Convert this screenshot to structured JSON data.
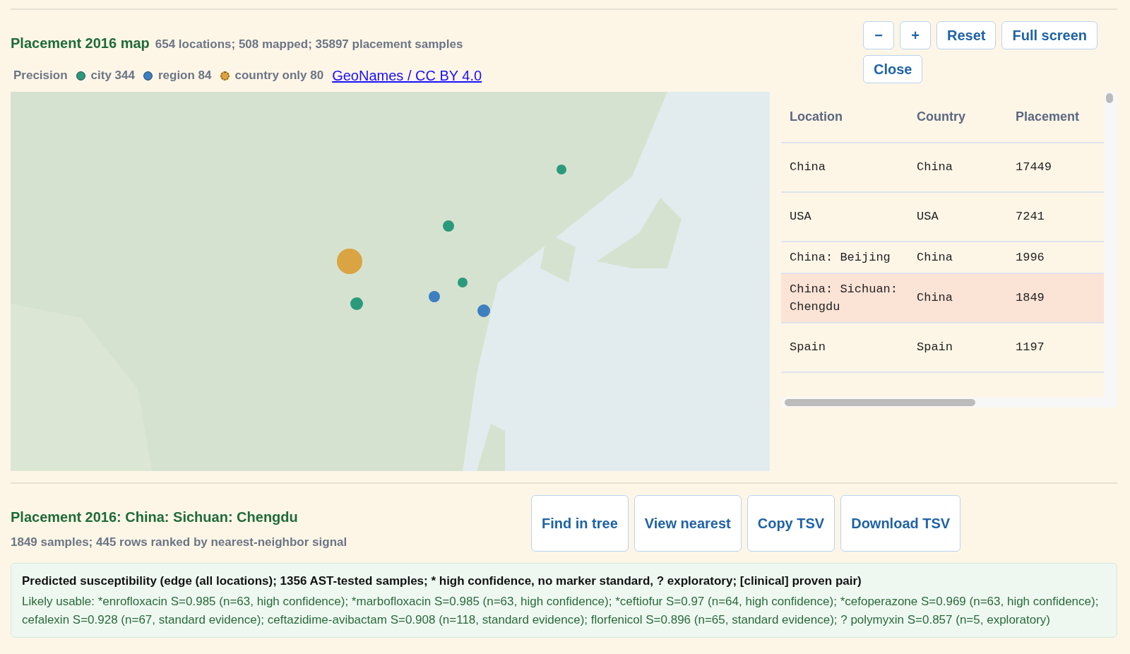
{
  "map_header": {
    "title": "Placement 2016 map",
    "summary": "654 locations; 508 mapped; 35897 placement samples"
  },
  "precision": {
    "label": "Precision",
    "items": [
      {
        "label": "city 344",
        "color": "#2a9a7c",
        "kind": "solid"
      },
      {
        "label": "region 84",
        "color": "#3d7fc0",
        "kind": "solid"
      },
      {
        "label": "country only 80",
        "color": "#d9a441",
        "kind": "dashed"
      }
    ],
    "link": "GeoNames / CC BY 4.0"
  },
  "map_buttons": [
    "−",
    "+",
    "Reset",
    "Full screen",
    "Close"
  ],
  "table": {
    "columns": [
      "Location",
      "Country",
      "Placement"
    ],
    "rows": [
      {
        "cells": [
          "China",
          "China",
          "17449"
        ],
        "selected": false
      },
      {
        "cells": [
          "USA",
          "USA",
          "7241"
        ],
        "selected": false
      },
      {
        "cells": [
          "China: Beijing",
          "China",
          "1996"
        ],
        "selected": false
      },
      {
        "cells": [
          "China: Sichuan: Chengdu",
          "China",
          "1849"
        ],
        "selected": true
      },
      {
        "cells": [
          "Spain",
          "Spain",
          "1197"
        ],
        "selected": false
      }
    ]
  },
  "detail": {
    "title": "Placement 2016: China: Sichuan: Chengdu",
    "summary": "1849 samples; 445 rows ranked by nearest-neighbor signal",
    "buttons": [
      "Find in tree",
      "View nearest",
      "Copy TSV",
      "Download TSV"
    ]
  },
  "prediction": {
    "heading": "Predicted susceptibility (edge (all locations); 1356 AST-tested samples; * high confidence, no marker standard, ? exploratory; [clinical] proven pair)",
    "text": "Likely usable: *enrofloxacin S=0.985 (n=63, high confidence); *marbofloxacin S=0.985 (n=63, high confidence); *ceftiofur S=0.97 (n=64, high confidence); *cefoperazone S=0.969 (n=63, high confidence); cefalexin S=0.928 (n=67, standard evidence); ceftazidime-avibactam S=0.908 (n=118, standard evidence); florfenicol S=0.896 (n=65, standard evidence); ? polymyxin S=0.857 (n=5, exploratory)"
  }
}
